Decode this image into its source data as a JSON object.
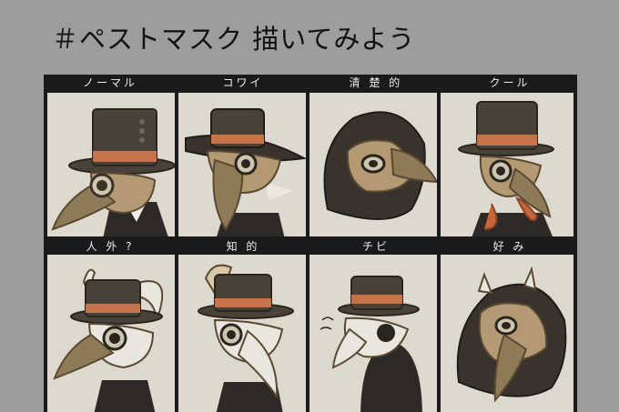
{
  "title": "＃ペストマスク 描いてみよう",
  "panels": [
    {
      "label": "ノーマル",
      "icon": "plague-doctor-tophat-icon"
    },
    {
      "label": "コワイ",
      "icon": "plague-doctor-wide-brim-icon"
    },
    {
      "label": "清 楚 的",
      "icon": "plague-doctor-hood-icon"
    },
    {
      "label": "クール",
      "icon": "plague-doctor-scarf-icon"
    },
    {
      "label": "人 外 ?",
      "icon": "plague-doctor-horned-icon"
    },
    {
      "label": "知 的",
      "icon": "plague-doctor-feather-icon"
    },
    {
      "label": "チビ",
      "icon": "plague-doctor-chibi-icon"
    },
    {
      "label": "好 み",
      "icon": "plague-doctor-horned-hood-icon"
    }
  ],
  "colors": {
    "background": "#9d9d9d",
    "frame": "#1a1a1a",
    "panel": "#ddd9cf",
    "hat": "#4a4139",
    "band": "#c7734a",
    "mask": "#b39a72",
    "beak": "#8f7a57",
    "scarf": "#c8663a"
  }
}
